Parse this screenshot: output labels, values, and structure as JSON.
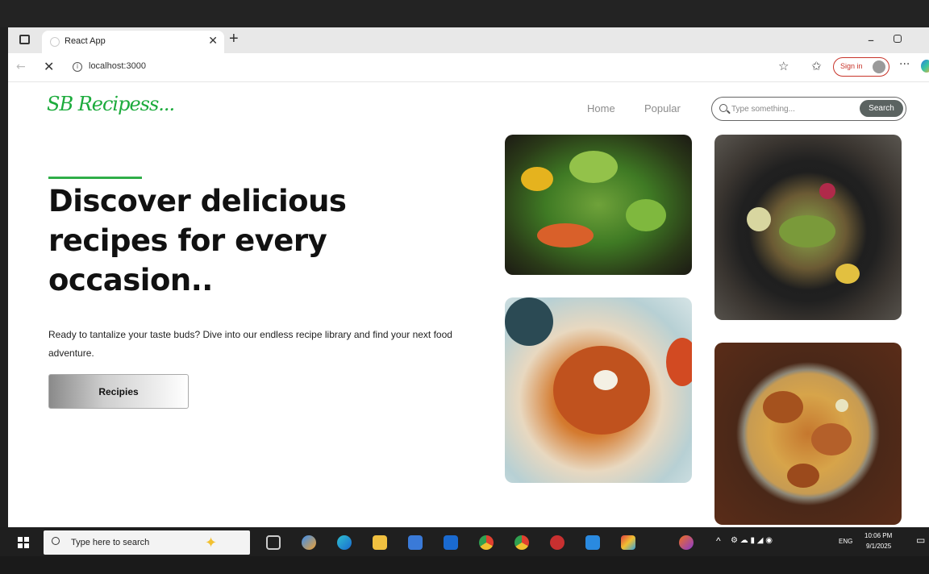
{
  "browser": {
    "tab_title": "React App",
    "url": "localhost:3000",
    "signin_label": "Sign in"
  },
  "site": {
    "logo": "SB Recipess...",
    "nav": {
      "home": "Home",
      "popular": "Popular"
    },
    "search": {
      "placeholder": "Type something...",
      "button": "Search"
    }
  },
  "hero": {
    "title": "Discover delicious recipes for every occasion..",
    "description": "Ready to tantalize your taste buds? Dive into our endless recipe library and find your next food adventure.",
    "button": "Recipies"
  },
  "taskbar": {
    "search_placeholder": "Type here to search",
    "language": "ENG",
    "time": "10:06 PM",
    "date": "9/1/2025"
  }
}
